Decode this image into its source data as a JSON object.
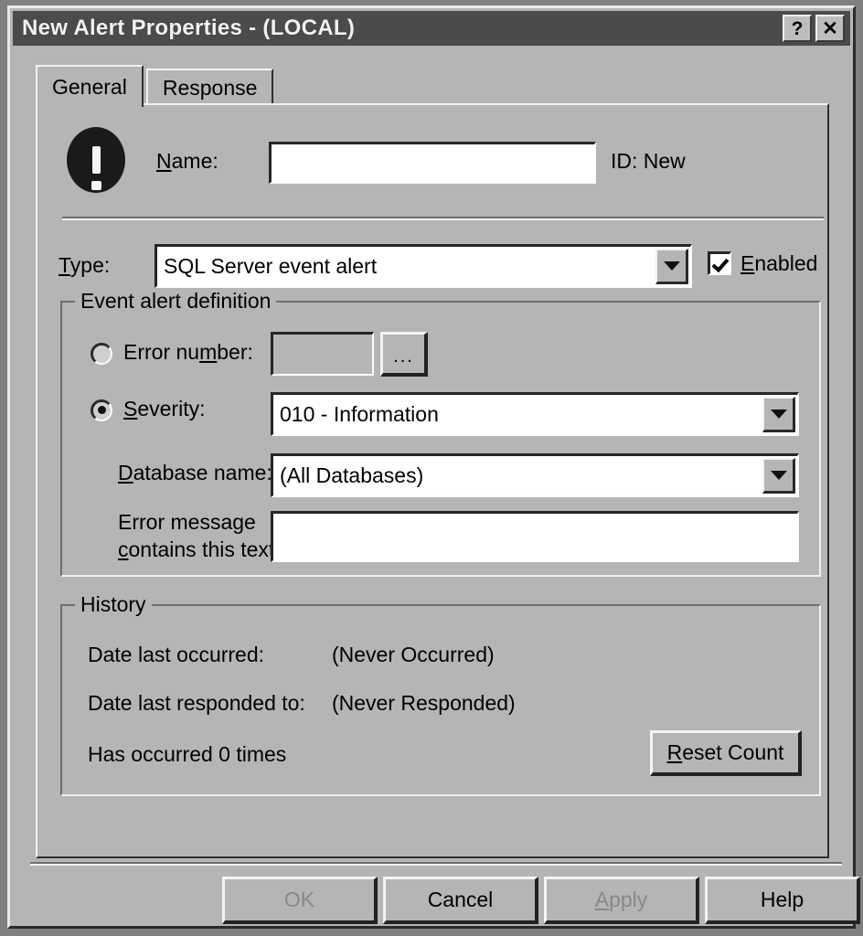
{
  "window": {
    "title": "New Alert Properties - (LOCAL)",
    "help_button": "?",
    "close_button": "✕"
  },
  "tabs": [
    {
      "label": "General",
      "active": true
    },
    {
      "label": "Response",
      "active": false
    }
  ],
  "general": {
    "alert_icon": "exclamation-alert-icon",
    "name_label": "Name:",
    "name_label_accel": "N",
    "name_value": "",
    "id_text": "ID: New",
    "type_label": "Type:",
    "type_label_accel": "T",
    "type_value": "SQL Server event alert",
    "enabled_label": "Enabled",
    "enabled_label_accel": "E",
    "enabled_checked": true,
    "event_group": {
      "legend": "Event alert definition",
      "error_number": {
        "label": "Error number:",
        "label_accel": "m",
        "selected": false,
        "value": "",
        "browse_button": "..."
      },
      "severity": {
        "label": "Severity:",
        "label_accel": "S",
        "selected": true,
        "value": "010 - Information"
      },
      "database_name": {
        "label": "Database name:",
        "label_accel": "D",
        "value": "(All Databases)"
      },
      "error_message": {
        "label_line1": "Error message",
        "label_line2": "contains this text:",
        "label_accel": "c",
        "value": ""
      }
    },
    "history_group": {
      "legend": "History",
      "rows": [
        {
          "label": "Date last occurred:",
          "value": "(Never Occurred)"
        },
        {
          "label": "Date last responded to:",
          "value": "(Never Responded)"
        }
      ],
      "occurrence_text": "Has occurred 0 times",
      "reset_button": "Reset Count",
      "reset_button_accel": "R"
    }
  },
  "footer": {
    "buttons": [
      {
        "label": "OK",
        "enabled": false
      },
      {
        "label": "Cancel",
        "enabled": true
      },
      {
        "label": "Apply",
        "enabled": false
      },
      {
        "label": "Help",
        "enabled": true
      }
    ]
  },
  "colors": {
    "face": "#b5b5b5",
    "titlebar": "#4b4b4b",
    "title_text": "#f2f2f2",
    "field": "#ffffff",
    "text": "#000000",
    "disabled_text": "#808080"
  }
}
